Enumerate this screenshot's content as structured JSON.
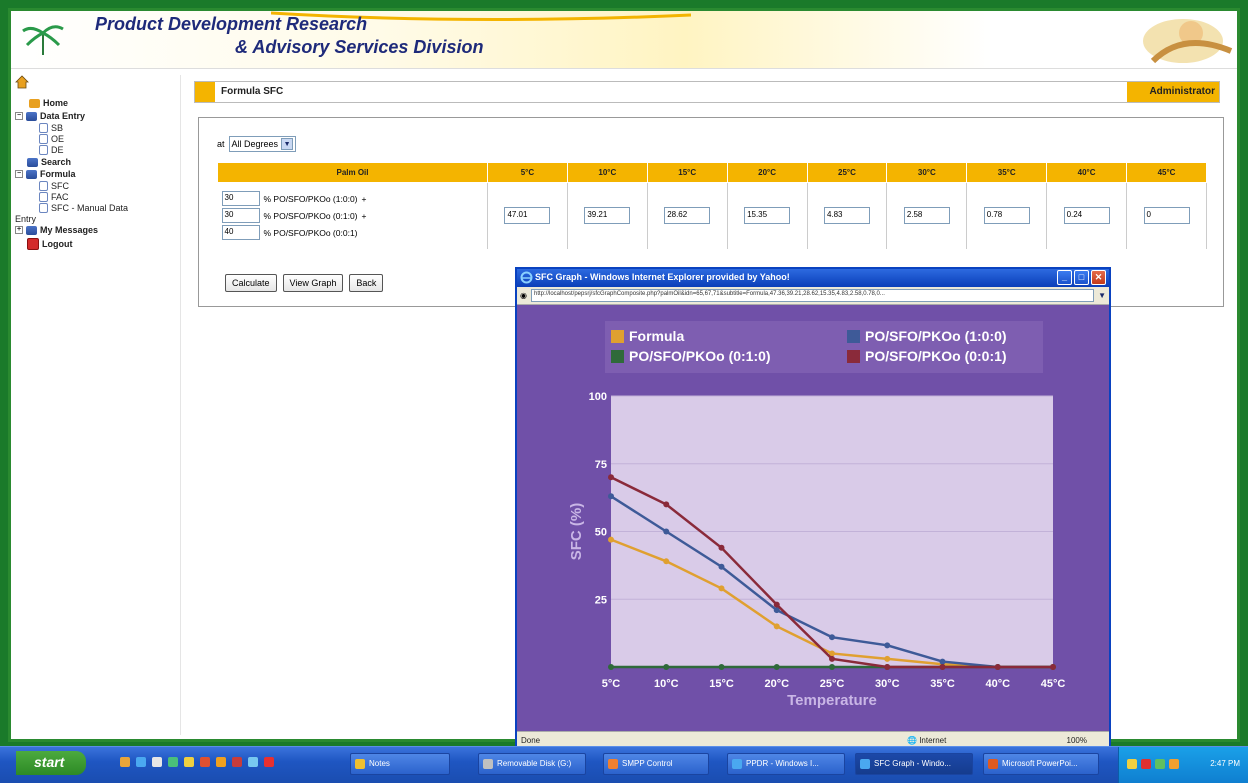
{
  "header": {
    "line1": "Product Development Research",
    "line2": "& Advisory Services Division"
  },
  "sidebar": {
    "items": [
      {
        "label": "Home"
      },
      {
        "label": "Data Entry"
      },
      {
        "label": "SB"
      },
      {
        "label": "OE"
      },
      {
        "label": "DE"
      },
      {
        "label": "Search"
      },
      {
        "label": "Formula"
      },
      {
        "label": "SFC"
      },
      {
        "label": "FAC"
      },
      {
        "label": "SFC - Manual Data"
      },
      {
        "label": "Entry"
      },
      {
        "label": "My Messages"
      },
      {
        "label": "Logout"
      }
    ]
  },
  "page": {
    "title": "Formula SFC",
    "role": "Administrator"
  },
  "form": {
    "degree_prefix": "at",
    "degree_value": "All Degrees",
    "table": {
      "headers": [
        "Palm Oil",
        "5°C",
        "10°C",
        "15°C",
        "20°C",
        "25°C",
        "30°C",
        "35°C",
        "40°C",
        "45°C"
      ],
      "oils": [
        {
          "pct": "30",
          "label": "% PO/SFO/PKOo (1:0:0)",
          "op": "+"
        },
        {
          "pct": "30",
          "label": "% PO/SFO/PKOo (0:1:0)",
          "op": "+"
        },
        {
          "pct": "40",
          "label": "% PO/SFO/PKOo (0:0:1)",
          "op": ""
        }
      ],
      "values": [
        "47.01",
        "39.21",
        "28.62",
        "15.35",
        "4.83",
        "2.58",
        "0.78",
        "0.24",
        "0"
      ]
    },
    "buttons": {
      "calculate": "Calculate",
      "view_graph": "View Graph",
      "back": "Back"
    }
  },
  "popup": {
    "title": "SFC Graph - Windows Internet Explorer provided by Yahoo!",
    "url": "http://localhost/pepsrj/sfcGraphComposite.php?palmOil&idn=65,67,71&subtitle=Formula,47.36,39.21,28.62,15.35,4.83,2.58,0.78,0...",
    "status": "Done",
    "zone": "Internet",
    "zoom": "100%"
  },
  "chart_data": {
    "type": "line",
    "categories": [
      "5°C",
      "10°C",
      "15°C",
      "20°C",
      "25°C",
      "30°C",
      "35°C",
      "40°C",
      "45°C"
    ],
    "xlabel": "Temperature",
    "ylabel": "SFC (%)",
    "ylim": [
      0,
      100
    ],
    "yticks": [
      25,
      50,
      75,
      100
    ],
    "legend_position": "top",
    "grid": true,
    "series": [
      {
        "name": "Formula",
        "color": "#e0a030",
        "values": [
          47,
          39,
          29,
          15,
          5,
          3,
          1,
          0,
          0
        ]
      },
      {
        "name": "PO/SFO/PKOo (1:0:0)",
        "color": "#3e5a98",
        "values": [
          63,
          50,
          37,
          21,
          11,
          8,
          2,
          0,
          0
        ]
      },
      {
        "name": "PO/SFO/PKOo (0:1:0)",
        "color": "#2f6a3a",
        "values": [
          0,
          0,
          0,
          0,
          0,
          0,
          0,
          0,
          0
        ]
      },
      {
        "name": "PO/SFO/PKOo (0:0:1)",
        "color": "#8a2a3a",
        "values": [
          70,
          60,
          44,
          23,
          3,
          0,
          0,
          0,
          0
        ]
      }
    ]
  },
  "taskbar": {
    "start": "start",
    "tasks": [
      {
        "label": "Notes"
      },
      {
        "label": "Removable Disk (G:)"
      },
      {
        "label": "SMPP Control"
      },
      {
        "label": "PPDR - Windows I..."
      },
      {
        "label": "SFC Graph - Windo..."
      },
      {
        "label": "Microsoft PowerPoi..."
      }
    ],
    "clock": "2:47 PM"
  }
}
